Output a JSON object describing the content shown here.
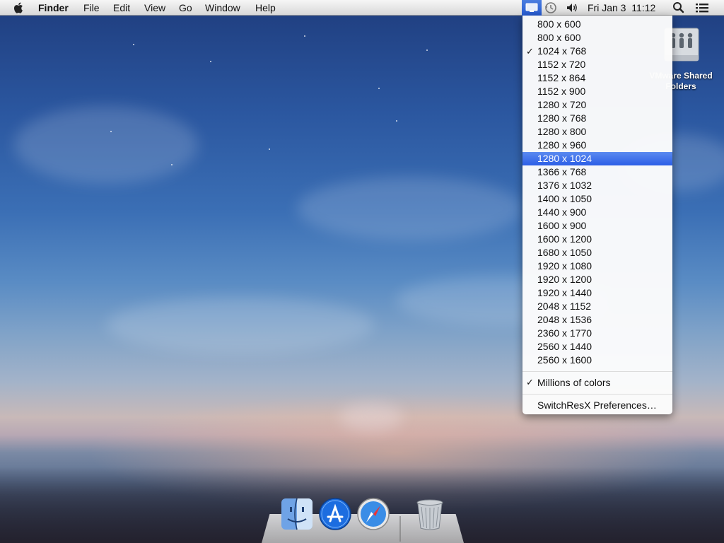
{
  "menubar": {
    "app_name": "Finder",
    "menus": [
      "File",
      "Edit",
      "View",
      "Go",
      "Window"
    ],
    "help": "Help",
    "clock": "Fri Jan 3  11:12"
  },
  "display_menu": {
    "resolutions": [
      {
        "label": "800 x 600",
        "checked": false,
        "selected": false
      },
      {
        "label": "800 x 600",
        "checked": false,
        "selected": false
      },
      {
        "label": "1024 x 768",
        "checked": true,
        "selected": false
      },
      {
        "label": "1152 x 720",
        "checked": false,
        "selected": false
      },
      {
        "label": "1152 x 864",
        "checked": false,
        "selected": false
      },
      {
        "label": "1152 x 900",
        "checked": false,
        "selected": false
      },
      {
        "label": "1280 x 720",
        "checked": false,
        "selected": false
      },
      {
        "label": "1280 x 768",
        "checked": false,
        "selected": false
      },
      {
        "label": "1280 x 800",
        "checked": false,
        "selected": false
      },
      {
        "label": "1280 x 960",
        "checked": false,
        "selected": false
      },
      {
        "label": "1280 x 1024",
        "checked": false,
        "selected": true
      },
      {
        "label": "1366 x 768",
        "checked": false,
        "selected": false
      },
      {
        "label": "1376 x 1032",
        "checked": false,
        "selected": false
      },
      {
        "label": "1400 x 1050",
        "checked": false,
        "selected": false
      },
      {
        "label": "1440 x 900",
        "checked": false,
        "selected": false
      },
      {
        "label": "1600 x 900",
        "checked": false,
        "selected": false
      },
      {
        "label": "1600 x 1200",
        "checked": false,
        "selected": false
      },
      {
        "label": "1680 x 1050",
        "checked": false,
        "selected": false
      },
      {
        "label": "1920 x 1080",
        "checked": false,
        "selected": false
      },
      {
        "label": "1920 x 1200",
        "checked": false,
        "selected": false
      },
      {
        "label": "1920 x 1440",
        "checked": false,
        "selected": false
      },
      {
        "label": "2048 x 1152",
        "checked": false,
        "selected": false
      },
      {
        "label": "2048 x 1536",
        "checked": false,
        "selected": false
      },
      {
        "label": "2360 x 1770",
        "checked": false,
        "selected": false
      },
      {
        "label": "2560 x 1440",
        "checked": false,
        "selected": false
      },
      {
        "label": "2560 x 1600",
        "checked": false,
        "selected": false
      }
    ],
    "colors_option": {
      "label": "Millions of colors",
      "checked": true
    },
    "preferences": "SwitchResX Preferences…"
  },
  "desktop_icon": {
    "label_line1": "VMware Shared",
    "label_line2": "Folders",
    "icon": "vmware-shared-folders-icon"
  },
  "dock": {
    "items": [
      "finder-icon",
      "app-store-icon",
      "safari-icon",
      "trash-icon"
    ]
  },
  "colors": {
    "menu_highlight": "#2c5ee6",
    "status_highlight": "#2559d0"
  }
}
